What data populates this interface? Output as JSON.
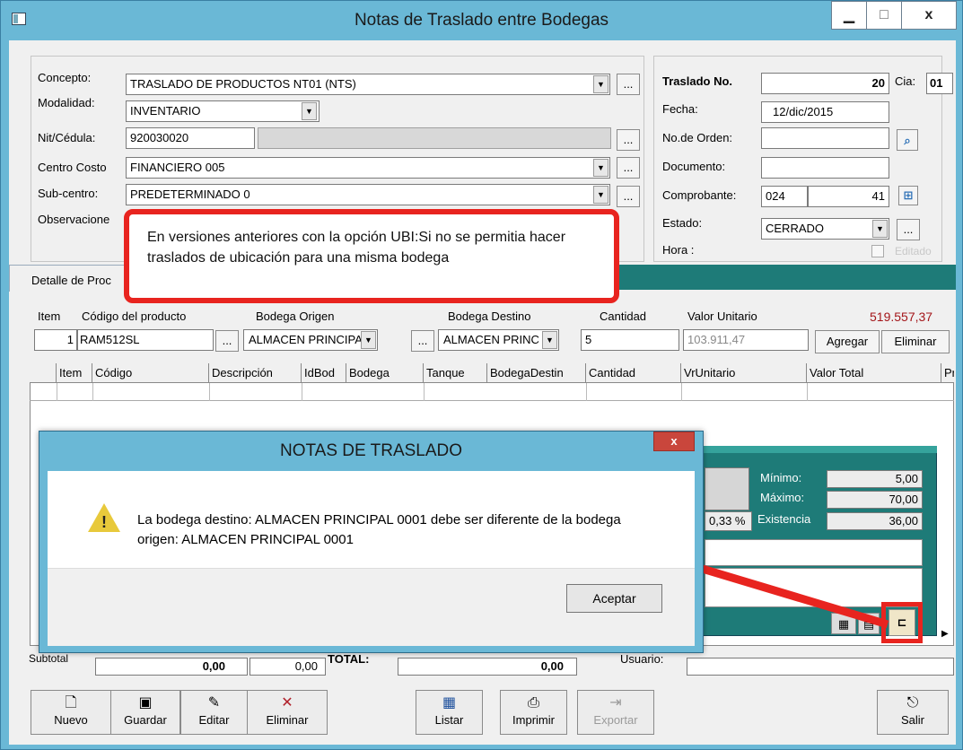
{
  "window": {
    "title": "Notas de Traslado entre Bodegas",
    "minimize": "▁",
    "maximize": "□",
    "close": "x"
  },
  "form": {
    "concepto_label": "Concepto:",
    "concepto_value": "TRASLADO DE PRODUCTOS NT01  (NTS)",
    "modalidad_label": "Modalidad:",
    "modalidad_value": "INVENTARIO",
    "nit_label": "Nit/Cédula:",
    "nit_value": "920030020",
    "centro_label": "Centro Costo",
    "centro_value": "FINANCIERO 005",
    "subcentro_label": "Sub-centro:",
    "subcentro_value": "PREDETERMINADO 0",
    "observaciones_label": "Observacione",
    "dots": "..."
  },
  "right_panel": {
    "traslado_label": "Traslado No.",
    "traslado_value": "20",
    "cia_label": "Cia:",
    "cia_value": "01",
    "fecha_label": "Fecha:",
    "fecha_value": "12/dic/2015",
    "orden_label": "No.de Orden:",
    "documento_label": "Documento:",
    "comprobante_label": "Comprobante:",
    "comprobante_code": "024",
    "comprobante_num": "41",
    "estado_label": "Estado:",
    "estado_value": "CERRADO",
    "hora_label": "Hora :",
    "editado_label": "Editado"
  },
  "callout": {
    "text": "En versiones anteriores con la opción UBI:Si no se permitia hacer traslados de ubicación para una misma bodega"
  },
  "detail": {
    "tab_label": "Detalle de Proc",
    "item_label": "Item",
    "codigo_label": "Código del producto",
    "origen_label": "Bodega Origen",
    "destino_label": "Bodega Destino",
    "cantidad_label": "Cantidad",
    "valor_label": "Valor Unitario",
    "total_value": "519.557,37",
    "item_value": "1",
    "codigo_value": "RAM512SL",
    "origen_value": "ALMACEN PRINCIPA",
    "destino_value": "ALMACEN PRINC",
    "cantidad_value": "5",
    "valor_value": "103.911,47",
    "agregar": "Agregar",
    "eliminar": "Eliminar"
  },
  "grid": {
    "columns": [
      "Item",
      "Código",
      "Descripción",
      "IdBod",
      "Bodega",
      "Tanque",
      "BodegaDestin",
      "Cantidad",
      "VrUnitario",
      "Valor Total",
      "Pr"
    ]
  },
  "stock": {
    "minimo_label": "Mínimo:",
    "minimo_value": "5,00",
    "maximo_label": "Máximo:",
    "maximo_value": "70,00",
    "existencia_label": "Existencia",
    "existencia_value": "36,00",
    "percent": "0,33 %"
  },
  "totals": {
    "subtotal_label": "Subtotal",
    "v1": "0,00",
    "v2": "0,00",
    "total_label": "TOTAL:",
    "v3": "0,00",
    "usuario_label": "Usuario:"
  },
  "dialog": {
    "title": "NOTAS DE TRASLADO",
    "close": "x",
    "message": "La bodega destino: ALMACEN PRINCIPAL 0001 debe ser diferente de la bodega origen: ALMACEN PRINCIPAL 0001",
    "ok": "Aceptar"
  },
  "toolbar": {
    "nuevo": "Nuevo",
    "guardar": "Guardar",
    "editar": "Editar",
    "eliminar": "Eliminar",
    "listar": "Listar",
    "imprimir": "Imprimir",
    "exportar": "Exportar",
    "salir": "Salir"
  },
  "colors": {
    "title_bar": "#6ab8d6",
    "panel": "#f0f0f0",
    "teal": "#1e7b78",
    "callout_border": "#e8241f",
    "total_red": "#a4161a"
  }
}
